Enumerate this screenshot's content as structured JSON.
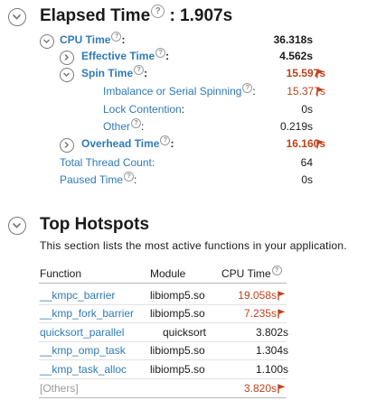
{
  "elapsed": {
    "title": "Elapsed Time",
    "help": "?",
    "value": ": 1.907s"
  },
  "metrics": [
    {
      "id": "cpu-time",
      "label": "CPU Time",
      "suffix": ":",
      "value": "36.318s",
      "flagged": false
    },
    {
      "id": "effective-time",
      "label": "Effective Time",
      "suffix": ":",
      "value": "4.562s",
      "flagged": false
    },
    {
      "id": "spin-time",
      "label": "Spin Time",
      "suffix": ":",
      "value": "15.597s",
      "flagged": true
    },
    {
      "id": "imbalance",
      "label": "Imbalance or Serial Spinning",
      "suffix": ":",
      "value": "15.377s",
      "flagged": true
    },
    {
      "id": "lock-contention",
      "label": "Lock Contention",
      "suffix": ":",
      "value": "0s",
      "flagged": false
    },
    {
      "id": "other",
      "label": "Other",
      "suffix": ":",
      "value": "0.219s",
      "flagged": false
    },
    {
      "id": "overhead-time",
      "label": "Overhead Time",
      "suffix": ":",
      "value": "16.160s",
      "flagged": true
    },
    {
      "id": "total-thread-count",
      "label": "Total Thread Count:",
      "suffix": "",
      "value": "64",
      "flagged": false
    },
    {
      "id": "paused-time",
      "label": "Paused Time",
      "suffix": ":",
      "value": "0s",
      "flagged": false
    }
  ],
  "hotspots": {
    "title": "Top Hotspots",
    "description": "This section lists the most active functions in your application.",
    "columns": {
      "function": "Function",
      "module": "Module",
      "cpu_time": "CPU Time"
    },
    "rows": [
      {
        "function": "__kmpc_barrier",
        "module": "libiomp5.so",
        "cpu_time": "19.058s",
        "flagged": true
      },
      {
        "function": "__kmp_fork_barrier",
        "module": "libiomp5.so",
        "cpu_time": "7.235s",
        "flagged": true
      },
      {
        "function": "quicksort_parallel",
        "module": "quicksort",
        "cpu_time": "3.802s",
        "flagged": false
      },
      {
        "function": "__kmp_omp_task",
        "module": "libiomp5.so",
        "cpu_time": "1.304s",
        "flagged": false
      },
      {
        "function": "__kmp_task_alloc",
        "module": "libiomp5.so",
        "cpu_time": "1.100s",
        "flagged": false
      },
      {
        "function": "[Others]",
        "module": "",
        "cpu_time": "3.820s",
        "flagged": true
      }
    ]
  },
  "colors": {
    "link_blue": "#2f7ab8",
    "flag_red": "#c0421c",
    "icon_gray": "#7a7a7a"
  },
  "icons": {
    "collapse": "chevron-down-circle-icon",
    "help": "help-question-icon",
    "flag": "red-flag-icon"
  }
}
